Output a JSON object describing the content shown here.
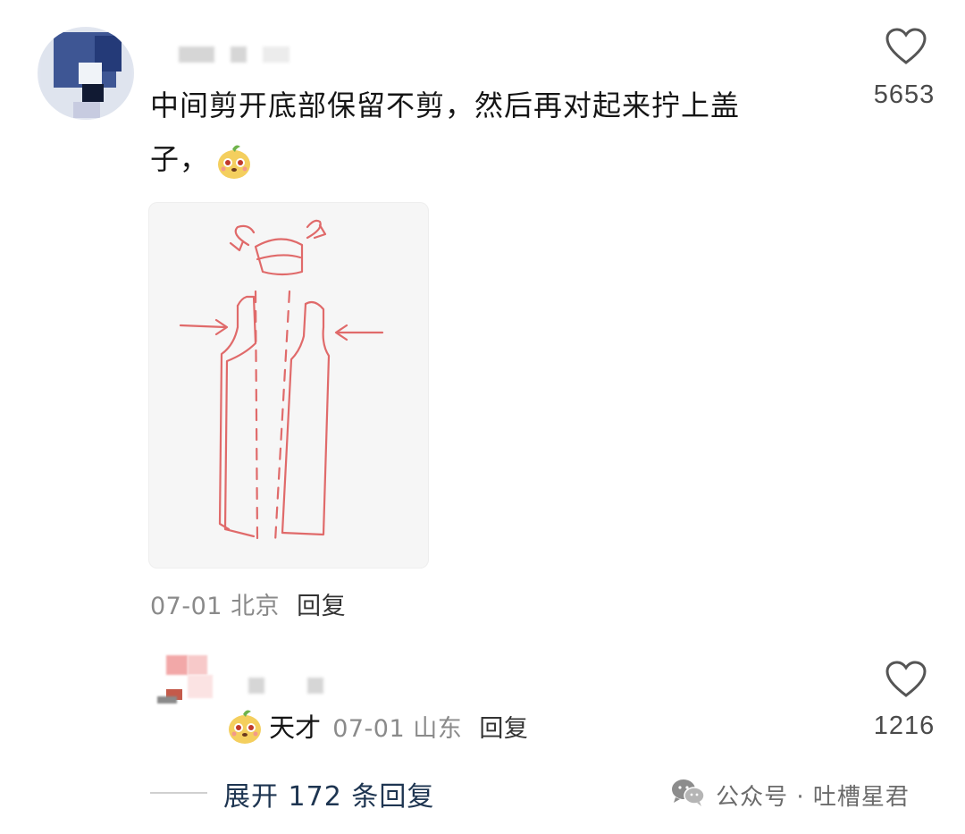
{
  "main_comment": {
    "text_line1": "中间剪开底部保留不剪，然后再对起来拧上盖",
    "text_line2": "子，",
    "like_count": "5653",
    "date": "07-01",
    "location": "北京",
    "reply_label": "回复",
    "emoji_icon": "bear-face-sticker-icon",
    "image_icon": "bottle-cutting-sketch-image"
  },
  "reply_comment": {
    "text": "天才",
    "date": "07-01",
    "location": "山东",
    "reply_label": "回复",
    "like_count": "1216",
    "emoji_icon": "bear-face-sticker-icon"
  },
  "expand": {
    "label": "展开 172 条回复"
  },
  "watermark": {
    "icon": "wechat-icon",
    "text": "公众号 · 吐槽星君"
  },
  "colors": {
    "sketch_ink": "#e06a6a",
    "link": "#1e3551",
    "meta": "#8a8a8a"
  }
}
